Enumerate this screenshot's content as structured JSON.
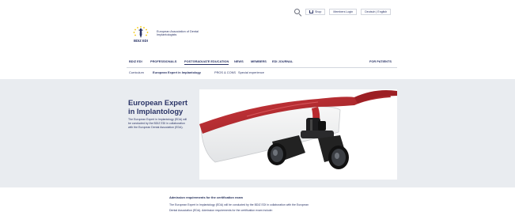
{
  "header": {
    "shop_label": "Shop",
    "members_login_label": "Members Login",
    "language_label": "Deutsch | English"
  },
  "logo": {
    "mark_text": "BDIZ EDI",
    "name_line1": "European Association of Dental",
    "name_line2": "Implantologists"
  },
  "main_nav": {
    "items": [
      {
        "label": "BDIZ EDI"
      },
      {
        "label": "PROFESSIONALS"
      },
      {
        "label": "POSTGRADUATE EDUCATION"
      },
      {
        "label": "NEWS"
      },
      {
        "label": "MEMBERS"
      },
      {
        "label": "EDI JOURNAL"
      }
    ],
    "patients_label": "FOR PATIENTS"
  },
  "sub_nav": {
    "items": [
      {
        "label": "Curriculum"
      },
      {
        "label": "European Expert in Implantology"
      },
      {
        "label": "PROS & CONS"
      },
      {
        "label": "Special experience"
      }
    ]
  },
  "hero": {
    "title": "European Expert in Implantology",
    "text": "The European Expert in Implantology (EDA) will be conducted by the BDIZ EDI in collaboration with the European Dental Association (EDA)."
  },
  "content": {
    "heading": "Admission requirements for the certification exam",
    "line1": "The European Expert in Implantology (EDA) will be conducted by the BDIZ EDI in collaboration with the European",
    "line2": "Dental Association (EDA). Admission requirements for the certification exam include:"
  },
  "colors": {
    "brand_navy": "#2b3567",
    "band_background": "#e9ecf0",
    "loupe_frame_red": "#b3262b"
  }
}
